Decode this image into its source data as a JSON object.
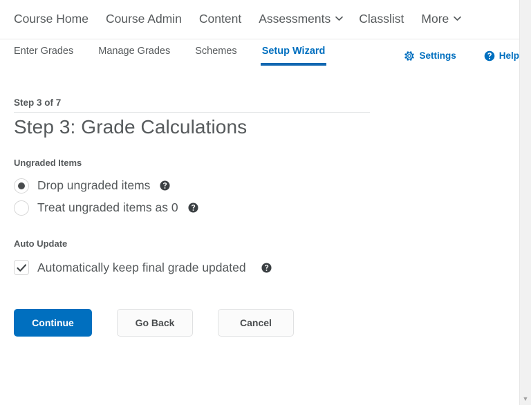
{
  "navbar": {
    "items": [
      {
        "label": "Course Home",
        "has_dropdown": false
      },
      {
        "label": "Course Admin",
        "has_dropdown": false
      },
      {
        "label": "Content",
        "has_dropdown": false
      },
      {
        "label": "Assessments",
        "has_dropdown": true
      },
      {
        "label": "Classlist",
        "has_dropdown": false
      },
      {
        "label": "More",
        "has_dropdown": true
      }
    ]
  },
  "subnav": {
    "tabs": [
      {
        "label": "Enter Grades",
        "active": false
      },
      {
        "label": "Manage Grades",
        "active": false
      },
      {
        "label": "Schemes",
        "active": false
      },
      {
        "label": "Setup Wizard",
        "active": true
      }
    ],
    "tools": [
      {
        "label": "Settings",
        "icon": "gear-icon"
      },
      {
        "label": "Help",
        "icon": "help-circle-icon"
      }
    ]
  },
  "main": {
    "step_counter": "Step 3 of 7",
    "title": "Step 3: Grade Calculations",
    "sections": [
      {
        "label": "Ungraded Items",
        "options": [
          {
            "label": "Drop ungraded items",
            "checked": true,
            "help_icon": "help-circle-icon"
          },
          {
            "label": "Treat ungraded items as 0",
            "checked": false,
            "help_icon": "help-circle-icon"
          }
        ]
      },
      {
        "label": "Auto Update",
        "options": [
          {
            "label": "Automatically keep final grade updated",
            "checked": true,
            "help_icon": "help-circle-icon"
          }
        ]
      }
    ],
    "buttons": [
      {
        "label": "Continue",
        "style": "primary"
      },
      {
        "label": "Go Back",
        "style": "secondary"
      },
      {
        "label": "Cancel",
        "style": "secondary"
      }
    ]
  },
  "scrollbar": {
    "down_arrow_glyph": "▼"
  },
  "colors": {
    "accent_blue": "#006fbf",
    "active_tab_underline": "#1267b1",
    "text": "#565a5c",
    "border": "#e0e1e2"
  }
}
